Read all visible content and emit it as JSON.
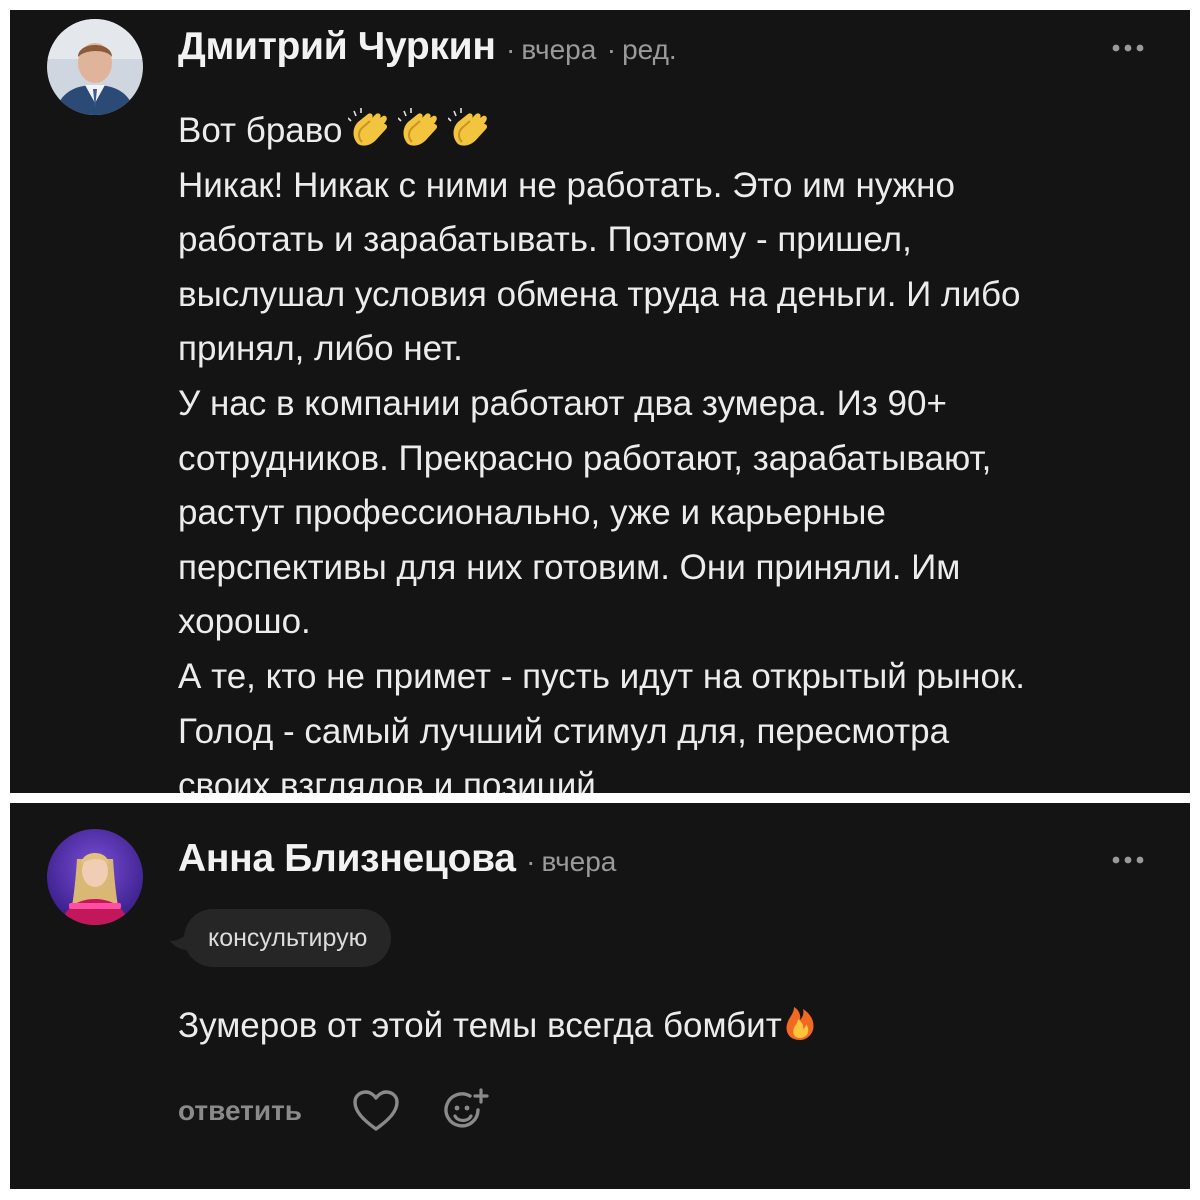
{
  "comments": [
    {
      "author": "Дмитрий Чуркин",
      "time": "вчера",
      "edited": "ред.",
      "more_icon": "more-horizontal-icon",
      "lines": [
        "Вот браво",
        "Никак! Никак с ними не работать. Это им нужно",
        "работать и зарабатывать. Поэтому - пришел,",
        "выслушал условия обмена труда на деньги. И либо",
        "принял, либо нет.",
        "У нас в компании работают два зумера. Из 90+",
        "сотрудников. Прекрасно работают, зарабатывают,",
        "растут профессионально, уже и карьерные",
        "перспективы для них готовим. Они приняли. Им",
        "хорошо.",
        "А те, кто не примет - пусть идут на открытый рынок.",
        "Голод - самый лучший стимул для, пересмотра",
        "своих взглядов и позиций"
      ],
      "emoji": [
        "clapping-hands",
        "clapping-hands",
        "clapping-hands"
      ]
    },
    {
      "author": "Анна Близнецова",
      "time": "вчера",
      "badge": "консультирую",
      "more_icon": "more-horizontal-icon",
      "text": "Зумеров от этой темы всегда бомбит",
      "emoji": "fire",
      "actions": {
        "reply_label": "ответить",
        "like_icon": "heart-icon",
        "reaction_icon": "add-reaction-icon"
      }
    }
  ],
  "colors": {
    "panel_bg": "#141414",
    "text": "#ececec",
    "muted": "#9a9a9a",
    "badge_bg": "#262626",
    "frame": "#ffffff"
  }
}
